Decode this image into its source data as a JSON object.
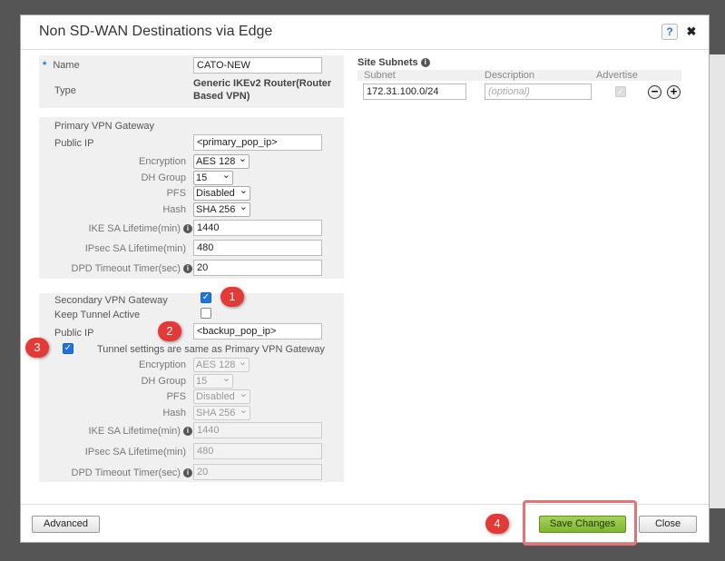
{
  "dialog": {
    "title": "Non SD-WAN Destinations via Edge",
    "help_icon": "?",
    "close_icon": "✖"
  },
  "general": {
    "name_required_mark": "*",
    "name_label": "Name",
    "name_value": "CATO-NEW",
    "type_label": "Type",
    "type_value_line1": "Generic IKEv2 Router(Router",
    "type_value_line2": "Based VPN)"
  },
  "primary": {
    "section_label": "Primary VPN Gateway",
    "public_ip_label": "Public IP",
    "public_ip_value": "<primary_pop_ip>",
    "encryption_label": "Encryption",
    "encryption_value": "AES 128",
    "dh_group_label": "DH Group",
    "dh_group_value": "15",
    "pfs_label": "PFS",
    "pfs_value": "Disabled",
    "hash_label": "Hash",
    "hash_value": "SHA 256",
    "ike_label": "IKE SA Lifetime(min)",
    "ike_value": "1440",
    "ipsec_label": "IPsec SA Lifetime(min)",
    "ipsec_value": "480",
    "dpd_label": "DPD Timeout Timer(sec)",
    "dpd_value": "20"
  },
  "secondary": {
    "section_label": "Secondary VPN Gateway",
    "keep_tunnel_label": "Keep Tunnel Active",
    "public_ip_label": "Public IP",
    "public_ip_value": "<backup_pop_ip>",
    "same_settings_label": "Tunnel settings are same as Primary VPN Gateway",
    "encryption_label": "Encryption",
    "encryption_value": "AES 128",
    "dh_group_label": "DH Group",
    "dh_group_value": "15",
    "pfs_label": "PFS",
    "pfs_value": "Disabled",
    "hash_label": "Hash",
    "hash_value": "SHA 256",
    "ike_label": "IKE SA Lifetime(min)",
    "ike_value": "1440",
    "ipsec_label": "IPsec SA Lifetime(min)",
    "ipsec_value": "480",
    "dpd_label": "DPD Timeout Timer(sec)",
    "dpd_value": "20"
  },
  "subnets": {
    "title": "Site Subnets",
    "col_subnet": "Subnet",
    "col_description": "Description",
    "col_advertise": "Advertise",
    "subnet_value": "172.31.100.0/24",
    "description_placeholder": "(optional)",
    "remove_icon": "−",
    "add_icon": "+"
  },
  "annotations": {
    "badge1": "1",
    "badge2": "2",
    "badge3": "3",
    "badge4": "4"
  },
  "footer": {
    "advanced_label": "Advanced",
    "save_label": "Save Changes",
    "close_label": "Close"
  },
  "colors": {
    "accent_blue": "#1a73e8",
    "save_green": "#8bc34a",
    "annotation_red": "#e53935"
  }
}
